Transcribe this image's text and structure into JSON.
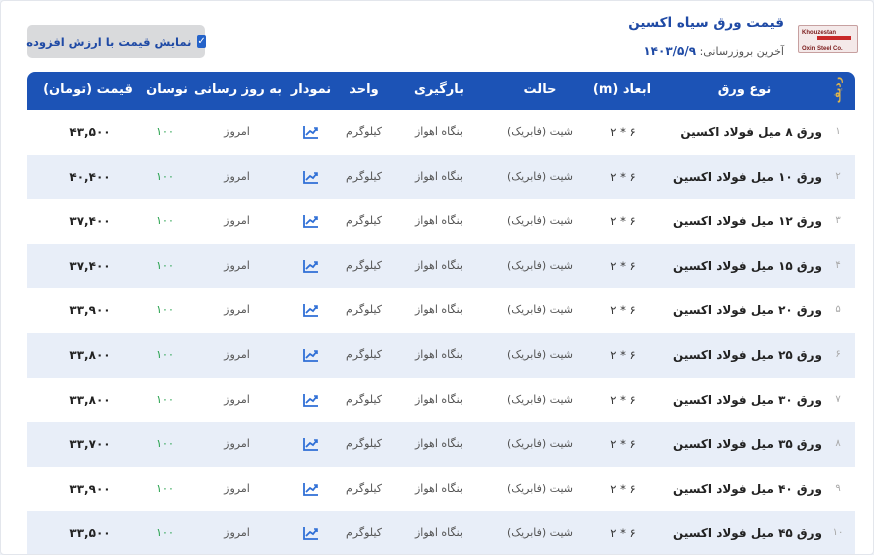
{
  "header": {
    "title": "قیمت ورق سیاه اکسین",
    "last_update_label": "آخرین بروزرسانی:",
    "last_update_date": "۱۴۰۳/۵/۹",
    "vat_toggle_label": "نمایش قیمت با ارزش افزوده",
    "vat_checked": true,
    "logo_text": "Khouzestan Oxin Steel Co."
  },
  "table": {
    "columns": {
      "idx": "ردیف",
      "name": "نوع ورق",
      "dim": "ابعاد (m)",
      "state": "حالت",
      "stock": "بارگیری",
      "unit": "واحد",
      "chart": "نمودار",
      "updated": "به روز رسانی",
      "change": "نوسان",
      "price": "قیمت (تومان)"
    },
    "rows": [
      {
        "idx": "۱",
        "name": "ورق ۸ میل فولاد اکسین",
        "dim": "۶ * ۲",
        "state": "شیت (فابریک)",
        "stock": "بنگاه اهواز",
        "unit": "کیلوگرم",
        "updated": "امروز",
        "change": "۱۰۰",
        "price": "۴۳,۵۰۰"
      },
      {
        "idx": "۲",
        "name": "ورق ۱۰ میل فولاد اکسین",
        "dim": "۶ * ۲",
        "state": "شیت (فابریک)",
        "stock": "بنگاه اهواز",
        "unit": "کیلوگرم",
        "updated": "امروز",
        "change": "۱۰۰",
        "price": "۴۰,۴۰۰"
      },
      {
        "idx": "۳",
        "name": "ورق ۱۲ میل فولاد اکسین",
        "dim": "۶ * ۲",
        "state": "شیت (فابریک)",
        "stock": "بنگاه اهواز",
        "unit": "کیلوگرم",
        "updated": "امروز",
        "change": "۱۰۰",
        "price": "۳۷,۴۰۰"
      },
      {
        "idx": "۴",
        "name": "ورق ۱۵ میل فولاد اکسین",
        "dim": "۶ * ۲",
        "state": "شیت (فابریک)",
        "stock": "بنگاه اهواز",
        "unit": "کیلوگرم",
        "updated": "امروز",
        "change": "۱۰۰",
        "price": "۳۷,۴۰۰"
      },
      {
        "idx": "۵",
        "name": "ورق ۲۰ میل فولاد اکسین",
        "dim": "۶ * ۲",
        "state": "شیت (فابریک)",
        "stock": "بنگاه اهواز",
        "unit": "کیلوگرم",
        "updated": "امروز",
        "change": "۱۰۰",
        "price": "۳۳,۹۰۰"
      },
      {
        "idx": "۶",
        "name": "ورق ۲۵ میل فولاد اکسین",
        "dim": "۶ * ۲",
        "state": "شیت (فابریک)",
        "stock": "بنگاه اهواز",
        "unit": "کیلوگرم",
        "updated": "امروز",
        "change": "۱۰۰",
        "price": "۳۳,۸۰۰"
      },
      {
        "idx": "۷",
        "name": "ورق ۳۰ میل فولاد اکسین",
        "dim": "۶ * ۲",
        "state": "شیت (فابریک)",
        "stock": "بنگاه اهواز",
        "unit": "کیلوگرم",
        "updated": "امروز",
        "change": "۱۰۰",
        "price": "۳۳,۸۰۰"
      },
      {
        "idx": "۸",
        "name": "ورق ۳۵ میل فولاد اکسین",
        "dim": "۶ * ۲",
        "state": "شیت (فابریک)",
        "stock": "بنگاه اهواز",
        "unit": "کیلوگرم",
        "updated": "امروز",
        "change": "۱۰۰",
        "price": "۳۳,۷۰۰"
      },
      {
        "idx": "۹",
        "name": "ورق ۴۰ میل فولاد اکسین",
        "dim": "۶ * ۲",
        "state": "شیت (فابریک)",
        "stock": "بنگاه اهواز",
        "unit": "کیلوگرم",
        "updated": "امروز",
        "change": "۱۰۰",
        "price": "۳۳,۹۰۰"
      },
      {
        "idx": "۱۰",
        "name": "ورق ۴۵ میل فولاد اکسین",
        "dim": "۶ * ۲",
        "state": "شیت (فابریک)",
        "stock": "بنگاه اهواز",
        "unit": "کیلوگرم",
        "updated": "امروز",
        "change": "۱۰۰",
        "price": "۳۳,۵۰۰"
      }
    ]
  },
  "colors": {
    "header_bg": "#1c53b6",
    "accent": "#1f4aa5",
    "row_alt": "#e8eef8",
    "change_up": "#23a04a"
  },
  "icons": {
    "chart": "trending-up-icon"
  }
}
